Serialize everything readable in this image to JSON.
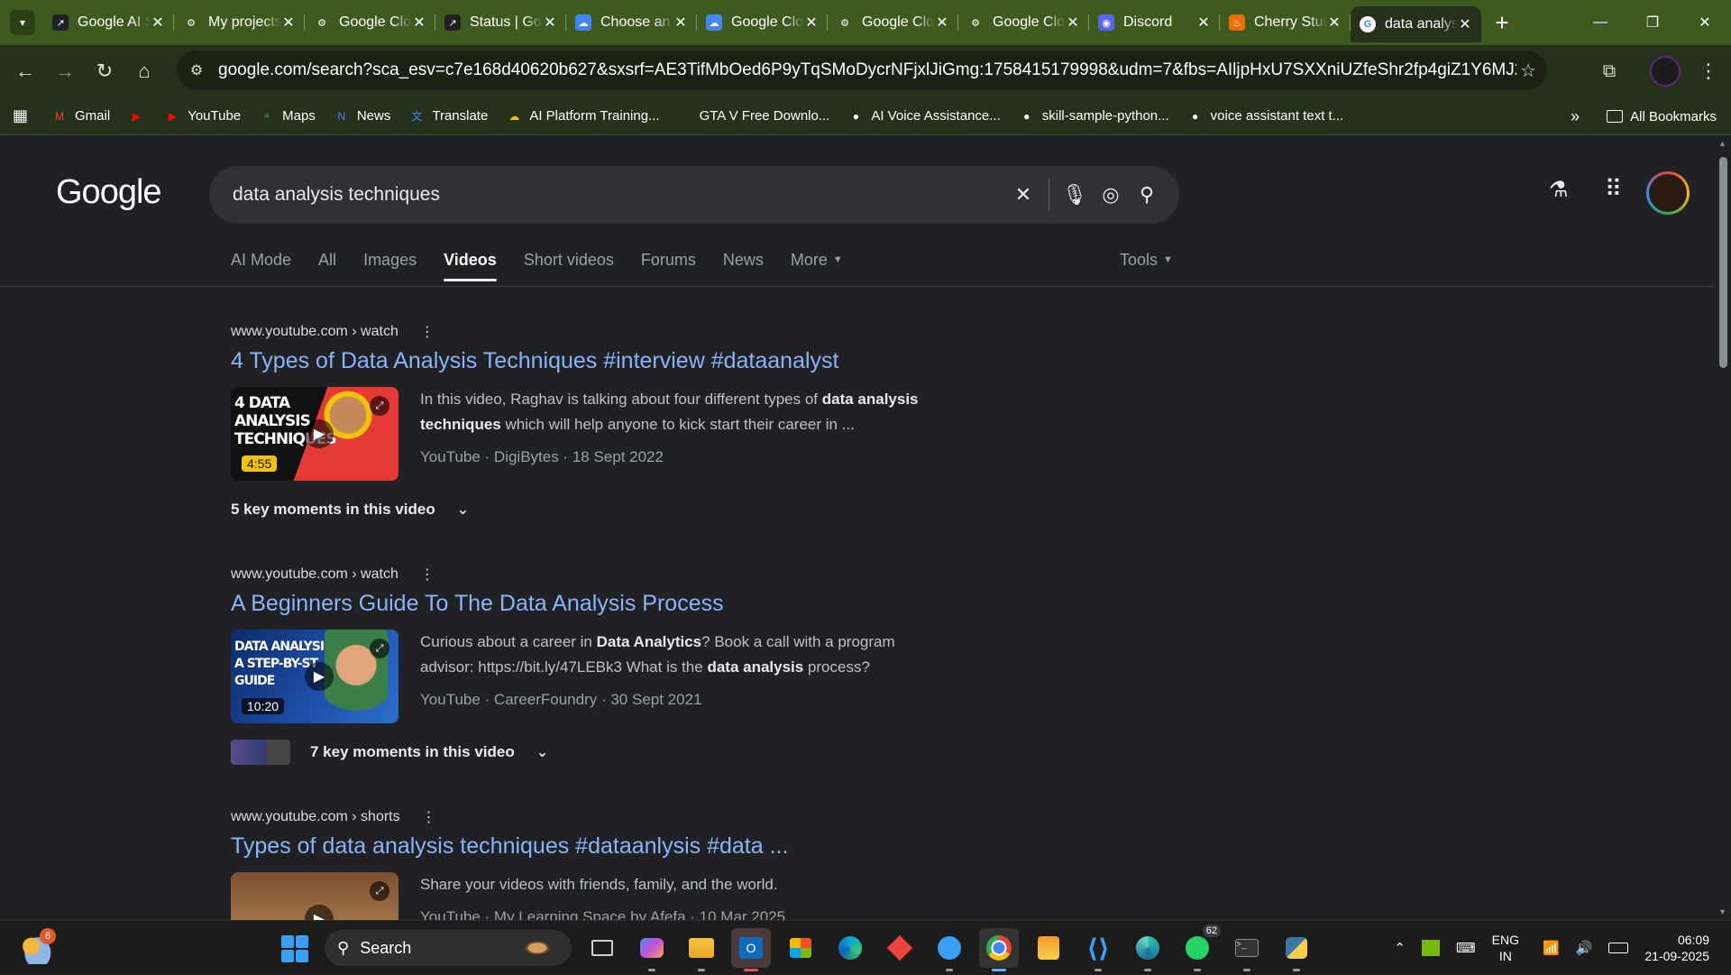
{
  "tabs": [
    {
      "label": "Google AI Studio",
      "icon": "external-icon",
      "color": "#202124"
    },
    {
      "label": "My projects",
      "icon": "openai-icon",
      "color": "#3f5a1f"
    },
    {
      "label": "Google Cloud",
      "icon": "openai-icon",
      "color": "#3f5a1f"
    },
    {
      "label": "Status | Google",
      "icon": "external-icon",
      "color": "#202124"
    },
    {
      "label": "Choose an account",
      "icon": "cloud-icon",
      "color": "#4285f4"
    },
    {
      "label": "Google Cloud",
      "icon": "cloud-icon",
      "color": "#4285f4"
    },
    {
      "label": "Google Cloud",
      "icon": "openai-icon",
      "color": "#3f5a1f"
    },
    {
      "label": "Google Cloud",
      "icon": "openai-icon",
      "color": "#3f5a1f"
    },
    {
      "label": "Discord",
      "icon": "discord-icon",
      "color": "#5865f2"
    },
    {
      "label": "Cherry Studio",
      "icon": "flame-icon",
      "color": "#ef6c00"
    },
    {
      "label": "data analysis techniques",
      "icon": "google-icon",
      "color": "#ffffff",
      "active": true
    }
  ],
  "omnibox": {
    "url": "google.com/search?sca_esv=c7e168d40620b627&sxsrf=AE3TifMbOed6P9yTqSMoDycrNFjxlJiGmg:1758415179998&udm=7&fbs=AIljpHxU7SXXniUZfeShr2fp4giZ1Y6MJ25_tmWITc7uy4Kl..."
  },
  "bookmarks": [
    {
      "label": "Gmail",
      "icon": "gmail-icon",
      "color": "#ea4335"
    },
    {
      "label": "",
      "icon": "youtube-icon",
      "color": "#ff0000"
    },
    {
      "label": "YouTube",
      "icon": "youtube-icon",
      "color": "#ff0000"
    },
    {
      "label": "Maps",
      "icon": "maps-icon",
      "color": "#34a853"
    },
    {
      "label": "News",
      "icon": "news-icon",
      "color": "#4285f4"
    },
    {
      "label": "Translate",
      "icon": "translate-icon",
      "color": "#4285f4"
    },
    {
      "label": "AI Platform Training...",
      "icon": "cloud-icon",
      "color": "#fbbc05"
    },
    {
      "label": "GTA V Free Downlo...",
      "icon": "",
      "color": ""
    },
    {
      "label": "AI Voice Assistance...",
      "icon": "github-icon",
      "color": "#ffffff"
    },
    {
      "label": "skill-sample-python...",
      "icon": "github-icon",
      "color": "#ffffff"
    },
    {
      "label": "voice assistant text t...",
      "icon": "github-icon",
      "color": "#ffffff"
    }
  ],
  "all_bookmarks": "All Bookmarks",
  "search": {
    "logo": "Google",
    "query": "data analysis techniques"
  },
  "nav_tabs": [
    "AI Mode",
    "All",
    "Images",
    "Videos",
    "Short videos",
    "Forums",
    "News",
    "More"
  ],
  "active_nav": "Videos",
  "tools_label": "Tools",
  "results": [
    {
      "cite": "www.youtube.com › watch",
      "title": "4 Types of Data Analysis Techniques #interview #dataanalyst",
      "snippet_parts": [
        "In this video, Raghav is talking about four different types of ",
        "data analysis techniques",
        " which will help anyone to kick start their career in ..."
      ],
      "meta": "YouTube · DigiBytes · 18 Sept 2022",
      "duration": "4:55",
      "thumb_text": "4 DATA\nANALYSIS\nTECHNIQUES",
      "moments": "5 key moments in this video"
    },
    {
      "cite": "www.youtube.com › watch",
      "title": "A Beginners Guide To The Data Analysis Process",
      "snippet_parts": [
        "Curious about a career in ",
        "Data Analytics",
        "? Book a call with a program advisor: https://bit.ly/47LEBk3 What is the ",
        "data analysis",
        " process?"
      ],
      "meta": "YouTube · CareerFoundry · 30 Sept 2021",
      "duration": "10:20",
      "thumb_text": "DATA ANALYSIS\nA STEP-BY-ST\nGUIDE",
      "moments": "7 key moments in this video"
    },
    {
      "cite": "www.youtube.com › shorts",
      "title": "Types of data analysis techniques #dataanlysis #data ...",
      "snippet_parts": [
        "Share your videos with friends, family, and the world."
      ],
      "meta": "YouTube · My Learning Space by Afefa · 10 Mar 2025"
    }
  ],
  "taskbar": {
    "weather_badge": "6",
    "search_label": "Search",
    "whatsapp_count": "62",
    "lang_top": "ENG",
    "lang_bottom": "IN",
    "time": "06:09",
    "date": "21-09-2025"
  }
}
